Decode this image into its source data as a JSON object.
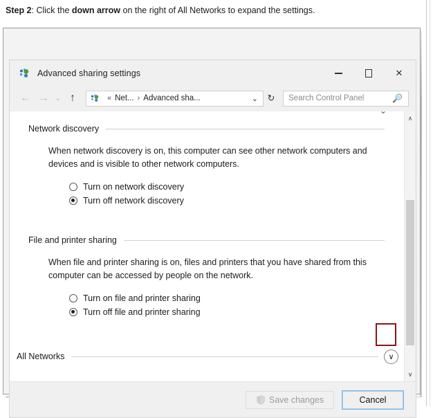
{
  "caption": {
    "step_label": "Step 2",
    "text_part1": ": Click the ",
    "bold_phrase": "down arrow",
    "text_part2": " on the right of All Networks to expand the settings."
  },
  "window": {
    "title": "Advanced sharing settings",
    "icon": "network-sharing-icon",
    "controls": {
      "minimize": "–",
      "maximize": "□",
      "close": "✕"
    }
  },
  "navbar": {
    "back": "←",
    "forward": "→",
    "recent": "⌄",
    "up": "↑",
    "address": {
      "icon": "network-sharing-icon",
      "overflow": "«",
      "crumb1": "Net...",
      "separator": "›",
      "crumb2": "Advanced sha...",
      "dropdown": "⌄"
    },
    "refresh": "↻",
    "search": {
      "placeholder": "Search Control Panel",
      "icon": "search-icon"
    }
  },
  "sections": [
    {
      "title": "Network discovery",
      "description": "When network discovery is on, this computer can see other network computers and devices and is visible to other network computers.",
      "options": [
        {
          "label": "Turn on network discovery",
          "checked": false
        },
        {
          "label": "Turn off network discovery",
          "checked": true
        }
      ]
    },
    {
      "title": "File and printer sharing",
      "description": "When file and printer sharing is on, files and printers that you have shared from this computer can be accessed by people on the network.",
      "options": [
        {
          "label": "Turn on file and printer sharing",
          "checked": false
        },
        {
          "label": "Turn off file and printer sharing",
          "checked": true
        }
      ]
    }
  ],
  "all_networks": {
    "label": "All Networks",
    "expander_icon": "chevron-down-icon",
    "expander_glyph": "∨",
    "highlight_color": "#8c1414"
  },
  "scrollbar": {
    "up_glyph": "∧",
    "down_glyph": "∨"
  },
  "footer": {
    "save_label": "Save changes",
    "save_icon": "uac-shield-icon",
    "cancel_label": "Cancel"
  }
}
